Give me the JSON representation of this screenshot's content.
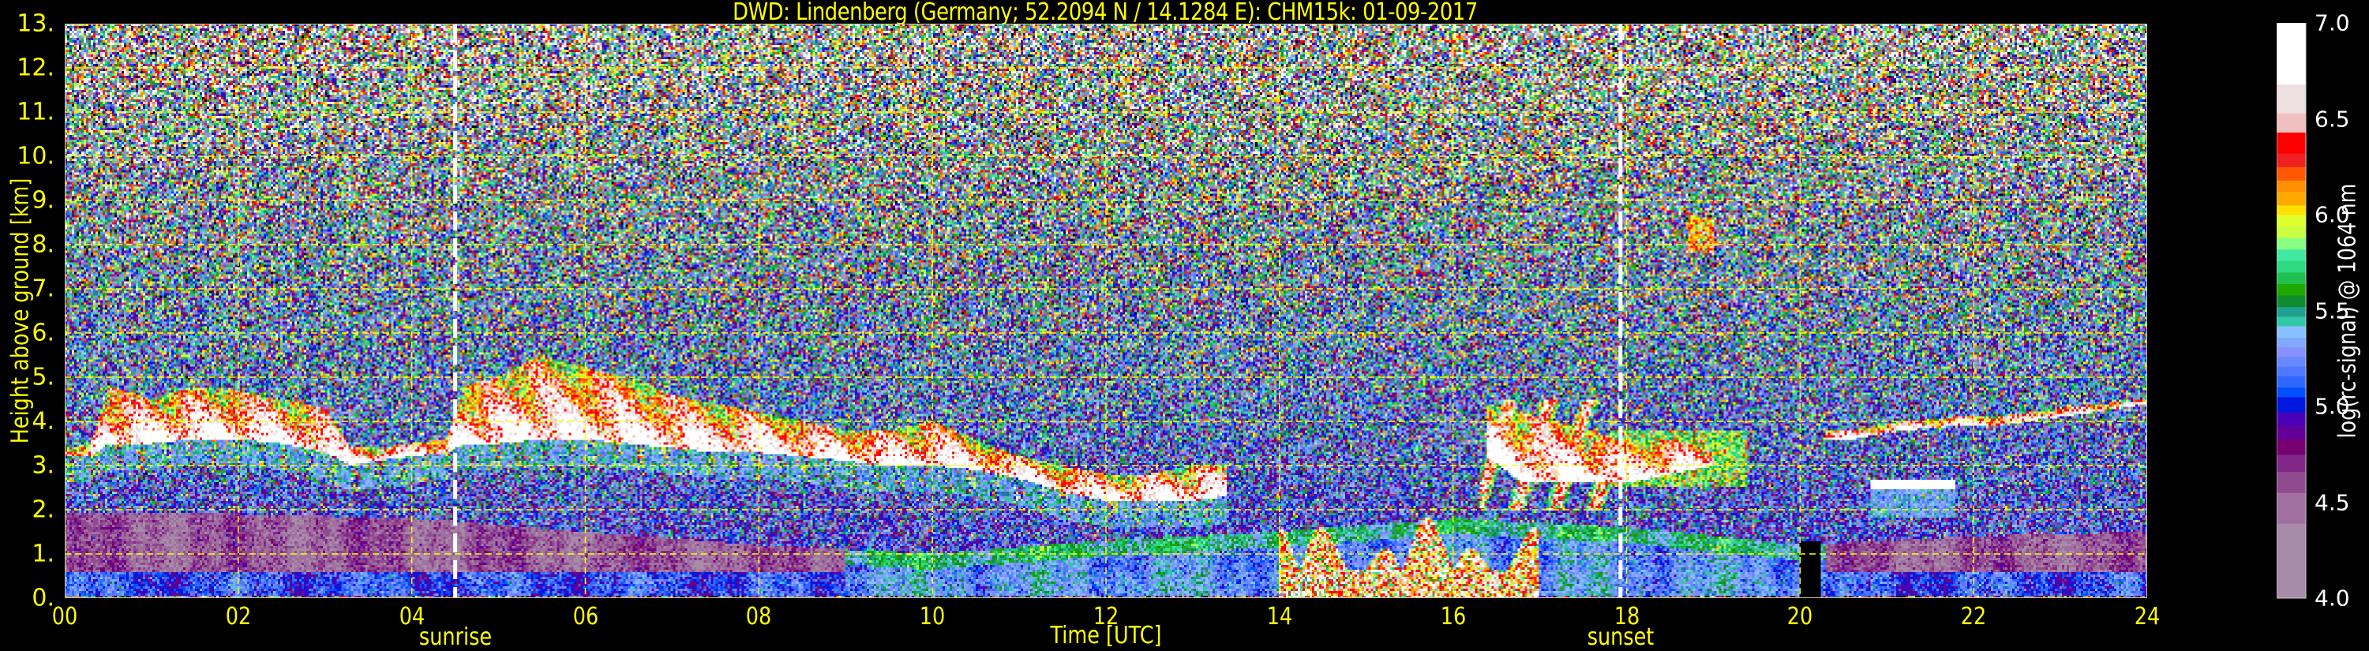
{
  "chart_data": {
    "type": "heatmap",
    "title": "DWD: Lindenberg (Germany; 52.2094 N / 14.1284 E):    CHM15k: 01-09-2017",
    "xlabel": "Time [UTC]",
    "ylabel": "Height above ground [km]",
    "xlim": [
      0,
      24
    ],
    "ylim": [
      0,
      13
    ],
    "x_ticks": [
      "00",
      "02",
      "04",
      "06",
      "08",
      "10",
      "12",
      "14",
      "16",
      "18",
      "20",
      "22",
      "24"
    ],
    "x_tick_values": [
      0,
      2,
      4,
      6,
      8,
      10,
      12,
      14,
      16,
      18,
      20,
      22,
      24
    ],
    "y_ticks": [
      "0.",
      "1.",
      "2.",
      "3.",
      "4.",
      "5.",
      "6.",
      "7.",
      "8.",
      "9.",
      "10.",
      "11.",
      "12.",
      "13."
    ],
    "y_tick_values": [
      0,
      1,
      2,
      3,
      4,
      5,
      6,
      7,
      8,
      9,
      10,
      11,
      12,
      13
    ],
    "grid": true,
    "grid_color": "#ffff00",
    "annotations": [
      {
        "label": "sunrise",
        "time": 4.5,
        "line_color": "#ffffff"
      },
      {
        "label": "sunset",
        "time": 17.93,
        "line_color": "#ffffff"
      }
    ],
    "colorbar": {
      "label": "log(rc-signal) @ 1064 nm",
      "range": [
        4.0,
        7.0
      ],
      "ticks": [
        "4.0",
        "4.5",
        "5.0",
        "5.5",
        "6.0",
        "6.5",
        "7.0"
      ],
      "tick_values": [
        4.0,
        4.5,
        5.0,
        5.5,
        6.0,
        6.5,
        7.0
      ],
      "under_color": "#000000",
      "levels": [
        [
          4.0,
          "#a88ba8"
        ],
        [
          4.39,
          "#a070a0"
        ],
        [
          4.55,
          "#904a90"
        ],
        [
          4.66,
          "#82268a"
        ],
        [
          4.75,
          "#76006f"
        ],
        [
          4.83,
          "#62009a"
        ],
        [
          4.9,
          "#4a00b8"
        ],
        [
          4.97,
          "#0018e0"
        ],
        [
          5.05,
          "#0050ff"
        ],
        [
          5.1,
          "#3068ff"
        ],
        [
          5.16,
          "#5078ff"
        ],
        [
          5.21,
          "#6888ff"
        ],
        [
          5.26,
          "#8890ff"
        ],
        [
          5.31,
          "#80a8ff"
        ],
        [
          5.36,
          "#88c0ff"
        ],
        [
          5.42,
          "#30c8a8"
        ],
        [
          5.47,
          "#20a090"
        ],
        [
          5.52,
          "#108c30"
        ],
        [
          5.58,
          "#20a800"
        ],
        [
          5.64,
          "#20c050"
        ],
        [
          5.7,
          "#30d880"
        ],
        [
          5.76,
          "#40e8a0"
        ],
        [
          5.82,
          "#88ff80"
        ],
        [
          5.88,
          "#c8ff40"
        ],
        [
          5.94,
          "#e0ff30"
        ],
        [
          6.0,
          "#ffe000"
        ],
        [
          6.05,
          "#ffa800"
        ],
        [
          6.12,
          "#ff9000"
        ],
        [
          6.18,
          "#ff5800"
        ],
        [
          6.25,
          "#f02020"
        ],
        [
          6.32,
          "#ff0000"
        ],
        [
          6.43,
          "#f0c0c0"
        ],
        [
          6.53,
          "#ece0e0"
        ],
        [
          6.68,
          "#ffffff"
        ]
      ]
    },
    "cloud_layer": {
      "time": [
        0,
        0.3,
        0.5,
        1,
        1.5,
        2,
        2.5,
        3,
        3.3,
        3.6,
        4,
        4.4,
        4.6,
        5,
        5.5,
        6,
        6.5,
        7,
        7.5,
        8,
        8.5,
        9,
        9.5,
        10,
        10.5,
        11,
        11.5,
        12,
        12.5,
        13,
        13.4,
        16.4,
        16.8,
        17.2,
        17.6,
        18,
        18.5,
        19,
        20.3,
        20.6,
        21.2,
        21.8,
        22.2,
        23,
        24
      ],
      "base": [
        3.2,
        3.2,
        3.5,
        3.5,
        3.6,
        3.6,
        3.5,
        3.3,
        3.0,
        3.1,
        3.2,
        3.3,
        3.5,
        3.5,
        3.6,
        3.6,
        3.5,
        3.4,
        3.3,
        3.3,
        3.2,
        3.1,
        3.0,
        3.0,
        2.9,
        2.7,
        2.4,
        2.2,
        2.2,
        2.2,
        2.3,
        3.2,
        2.6,
        2.6,
        2.6,
        2.6,
        2.8,
        3.0,
        3.6,
        3.6,
        3.8,
        3.9,
        3.9,
        4.1,
        4.4
      ],
      "top": [
        3.4,
        3.5,
        4.8,
        4.5,
        4.8,
        4.7,
        4.5,
        4.3,
        3.4,
        3.4,
        3.5,
        3.6,
        4.8,
        5.0,
        5.5,
        5.2,
        5.0,
        4.6,
        4.4,
        4.2,
        4.0,
        3.8,
        3.8,
        4.0,
        3.6,
        3.2,
        3.0,
        2.8,
        2.8,
        3.0,
        3.0,
        4.4,
        4.2,
        4.0,
        3.8,
        3.5,
        3.6,
        3.4,
        3.8,
        3.8,
        4.0,
        4.1,
        4.1,
        4.3,
        4.5
      ]
    },
    "secondary_layer": {
      "time": [
        20.8,
        21.8
      ],
      "base": 2.45,
      "top": 2.65
    },
    "low_cloud": {
      "time": [
        14.0,
        17.0
      ],
      "base": 0.0,
      "top": 1.6
    },
    "boundary_layer_top": {
      "time": [
        0,
        2,
        4,
        6,
        8,
        10,
        12,
        14,
        16,
        18,
        20,
        22,
        24
      ],
      "height": [
        1.9,
        1.9,
        1.8,
        1.5,
        1.2,
        1.0,
        1.3,
        1.5,
        1.8,
        1.6,
        1.2,
        1.4,
        1.5
      ]
    }
  }
}
